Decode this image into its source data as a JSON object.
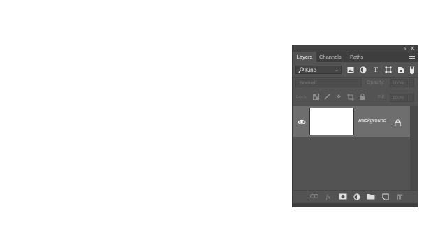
{
  "panel": {
    "collapse_icon": "double-chevron-icon",
    "close_label": "✕",
    "collapse_label": "«",
    "tabs": [
      {
        "label": "Layers",
        "active": true
      },
      {
        "label": "Channels",
        "active": false
      },
      {
        "label": "Paths",
        "active": false
      }
    ],
    "menu_icon": "hamburger-menu-icon"
  },
  "filter": {
    "kind_label": "Kind",
    "icons": [
      "pixel-layer-filter-icon",
      "adjustment-layer-filter-icon",
      "type-layer-filter-icon",
      "shape-layer-filter-icon",
      "smart-object-filter-icon"
    ],
    "type_glyph": "T"
  },
  "blend": {
    "mode": "Normal",
    "opacity_label": "Opacity:",
    "opacity_value": "100%"
  },
  "lock": {
    "label": "Lock:",
    "fill_label": "Fill:",
    "fill_value": "100%"
  },
  "layers": [
    {
      "name": "Background",
      "visible": true,
      "locked": true
    }
  ],
  "bottom_icons": [
    "link-layers-icon",
    "fx-icon",
    "add-mask-icon",
    "adjustment-layer-icon",
    "new-group-icon",
    "new-layer-icon",
    "delete-layer-icon"
  ],
  "fx_label": "fx",
  "colors": {
    "panel_bg": "#535353",
    "tab_bar": "#3e3e3e",
    "selected_layer": "#6e6e6e"
  }
}
